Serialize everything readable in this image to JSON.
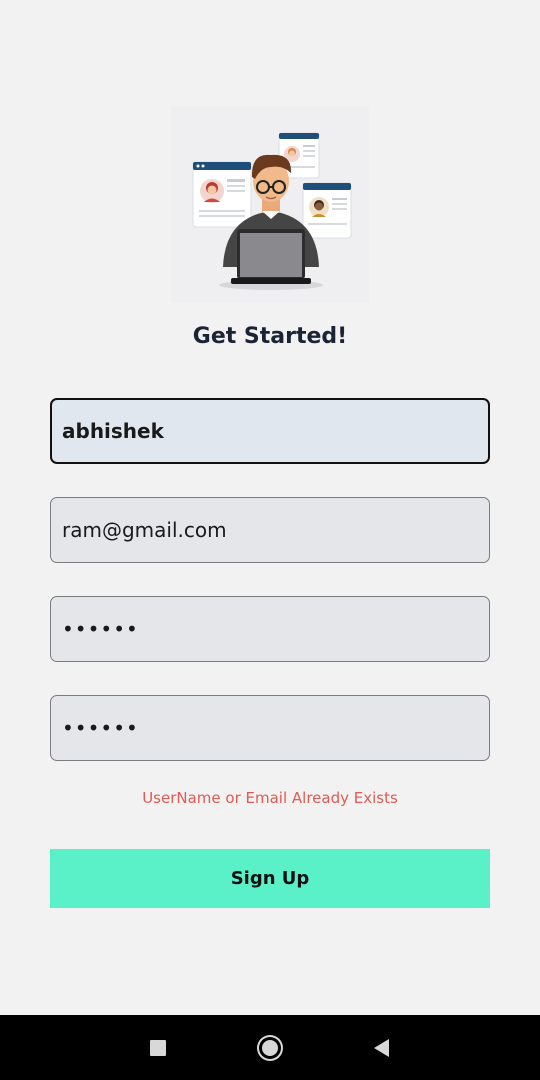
{
  "signup": {
    "title": "Get Started!",
    "username_value": "abhishek",
    "email_value": "ram@gmail.com",
    "password_value": "••••••",
    "confirm_password_value": "••••••",
    "error_message": "UserName or Email Already Exists",
    "submit_label": "Sign Up"
  },
  "colors": {
    "background": "#f2f2f2",
    "field_background": "#e5e6ea",
    "focused_field_background": "#e1e7ef",
    "error_text": "#e05b55",
    "button_background": "#5af0c8",
    "title_text": "#1b2436",
    "navbar": "#000000"
  },
  "illustration": {
    "icon": "developer-with-laptop-and-profile-cards-illustration"
  },
  "navbar": {
    "recents_icon": "square-icon",
    "home_icon": "circle-icon",
    "back_icon": "triangle-back-icon"
  }
}
